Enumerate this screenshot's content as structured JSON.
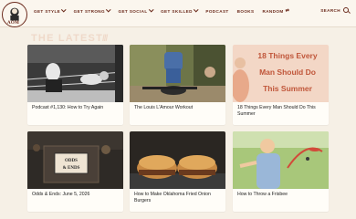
{
  "site": {
    "logo_text": "AOM"
  },
  "nav": {
    "items": [
      {
        "label": "GET STYLE",
        "has_dropdown": true
      },
      {
        "label": "GET STRONG",
        "has_dropdown": true
      },
      {
        "label": "GET SOCIAL",
        "has_dropdown": true
      },
      {
        "label": "GET SKILLED",
        "has_dropdown": true
      },
      {
        "label": "PODCAST",
        "has_dropdown": false
      },
      {
        "label": "BOOKS",
        "has_dropdown": false
      },
      {
        "label": "RANDOM",
        "has_dropdown": false,
        "icon": "shuffle-icon"
      }
    ],
    "search_label": "SEARCH"
  },
  "section": {
    "title": "THE LATEST"
  },
  "cards": [
    {
      "title": "Podcast #1,130: How to Try Again",
      "image": "boxer-in-ring"
    },
    {
      "title": "The Louis L'Amour Workout",
      "image": "weightlifter-outdoors"
    },
    {
      "title": "18 Things Every Man Should Do This Summer",
      "image": "summer-illustration",
      "image_text": "18 Things Every Man Should Do This Summer"
    },
    {
      "title": "Odds & Ends: June 5, 2026",
      "image": "odds-ends-box",
      "image_text": "ODDS & ENDS"
    },
    {
      "title": "How to Make Oklahoma Fried Onion Burgers",
      "image": "onion-burgers"
    },
    {
      "title": "How to Throw a Frisbee",
      "image": "frisbee-illustration"
    }
  ],
  "colors": {
    "brand": "#6b2a1c",
    "background": "#f6f0e6",
    "heading_faded": "#efd9c9"
  }
}
